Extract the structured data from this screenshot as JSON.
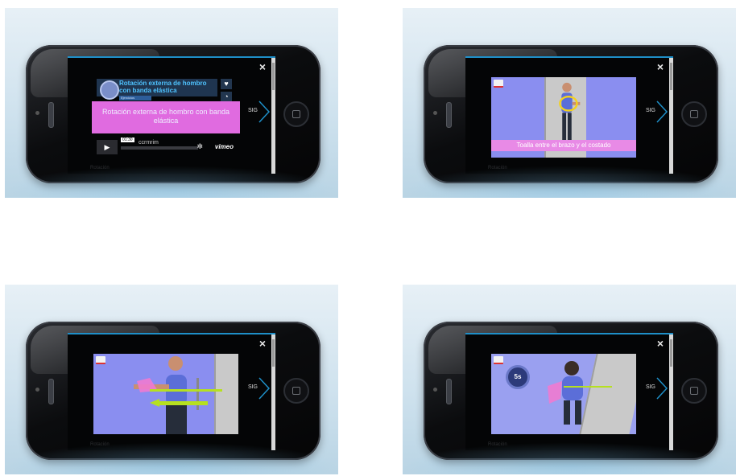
{
  "panels": [
    {
      "id": "panel-top-left",
      "close_icon": "×",
      "next_label": "SIG",
      "footer_text": "Rotación",
      "exercise_title": "Rotación externa de hombro con banda elástica",
      "badge_text": "Ejercicios",
      "video_label": "Rotación externa de hombro con banda elástica",
      "player_time": "01:30",
      "player_caption": "ccrmrim",
      "player_brand": "vimeo",
      "icons": [
        "heart-icon",
        "clock-icon",
        "play-icon",
        "settings-icon"
      ]
    },
    {
      "id": "panel-top-right",
      "close_icon": "×",
      "next_label": "SIG",
      "footer_text": "Rotación",
      "subtitle": "Toalla entre el brazo y el costado"
    },
    {
      "id": "panel-bottom-left",
      "close_icon": "×",
      "next_label": "SIG",
      "footer_text": "Rotación"
    },
    {
      "id": "panel-bottom-right",
      "close_icon": "×",
      "next_label": "SIG",
      "footer_text": "Rotación",
      "timer_text": "5s"
    }
  ],
  "colors": {
    "accent_blue": "#1e8fc8",
    "video_bg": "#8a8ef0",
    "magenta": "#e06be0",
    "band_pink": "#f07ad0",
    "arrow_green": "#b6e020"
  }
}
